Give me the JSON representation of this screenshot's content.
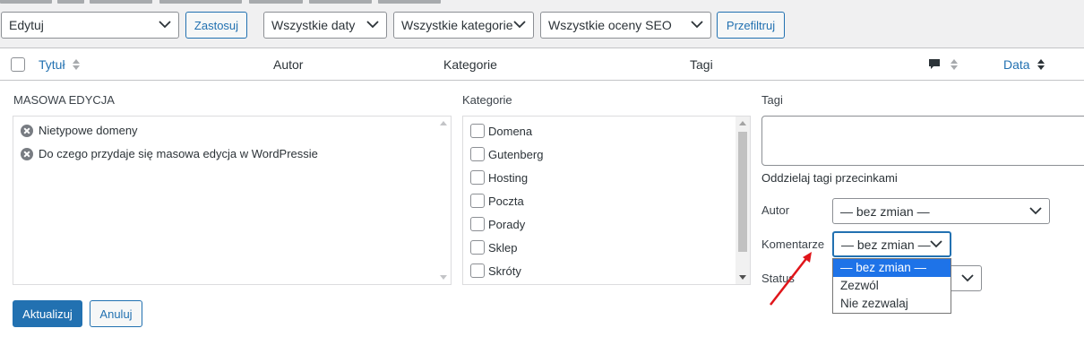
{
  "bulk_actions": {
    "value": "Edytuj",
    "apply_label": "Zastosuj"
  },
  "filters": {
    "dates": "Wszystkie daty",
    "categories": "Wszystkie kategorie",
    "seo": "Wszystkie oceny SEO",
    "filter_label": "Przefiltruj"
  },
  "columns": {
    "title": "Tytuł",
    "author": "Autor",
    "categories": "Kategorie",
    "tags": "Tagi",
    "date": "Data"
  },
  "bulk_edit": {
    "heading": "MASOWA EDYCJA",
    "posts": [
      "Nietypowe domeny",
      "Do czego przydaje się masowa edycja w WordPressie"
    ],
    "categories_label": "Kategorie",
    "categories": [
      "Domena",
      "Gutenberg",
      "Hosting",
      "Poczta",
      "Porady",
      "Sklep",
      "Skróty"
    ],
    "tags_label": "Tagi",
    "tags_hint": "Oddzielaj tagi przecinkami",
    "author_label": "Autor",
    "author_value": "— bez zmian —",
    "comments_label": "Komentarze",
    "comments_value": "— bez zmian —",
    "status_label": "Status",
    "comments_options": [
      "— bez zmian —",
      "Zezwól",
      "Nie zezwalaj"
    ],
    "update_label": "Aktualizuj",
    "cancel_label": "Anuluj"
  },
  "colors": {
    "accent": "#2271b1",
    "selected_option": "#1e73e8",
    "annotation_arrow": "#e0151a"
  }
}
